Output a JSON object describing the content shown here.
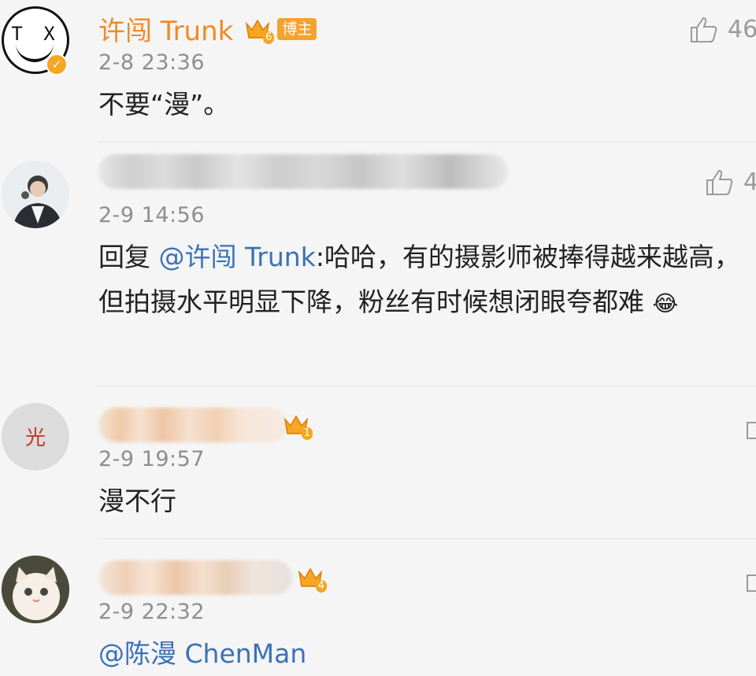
{
  "comments": [
    {
      "author": "许闯 Trunk",
      "crown_level": "6",
      "role_badge": "博主",
      "time": "2-8 23:36",
      "text": "不要“漫”。",
      "likes": "46",
      "avatar_letters": "T X"
    },
    {
      "author": "",
      "time": "2-9 14:56",
      "reply_prefix": "回复 ",
      "mention": "@许闯 Trunk",
      "text": ":哈哈，有的摄影师被捧得越来越高，但拍摄水平明显下降，粉丝有时候想闭眼夸都难",
      "emoji": "😂",
      "likes": "4"
    },
    {
      "author": "",
      "crown_level": "1",
      "time": "2-9 19:57",
      "text": "漫不行",
      "avatar_char": "光"
    },
    {
      "author": "",
      "crown_level": "4",
      "time": "2-9 22:32",
      "mention": "@陈漫 ChenMan"
    }
  ],
  "colors": {
    "author": "#f08a25",
    "mention": "#3a72b5",
    "time": "#8e8e8e",
    "verified": "#f5a623"
  }
}
